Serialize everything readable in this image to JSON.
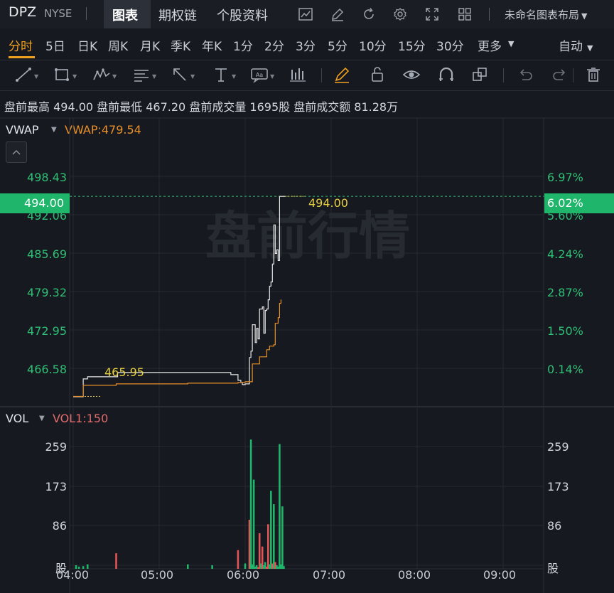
{
  "header": {
    "ticker": "DPZ",
    "exchange": "NYSE",
    "tabs": [
      "图表",
      "期权链",
      "个股资料"
    ],
    "active_tab": "图表",
    "layout_label": "未命名图表布局"
  },
  "periods": {
    "items": [
      "分时",
      "5日",
      "日K",
      "周K",
      "月K",
      "季K",
      "年K",
      "1分",
      "2分",
      "3分",
      "5分",
      "10分",
      "15分",
      "30分",
      "更多"
    ],
    "active": "分时",
    "mode": "自动"
  },
  "drawing_tools": [
    "line-tool-icon",
    "rectangle-tool-icon",
    "pattern-tool-icon",
    "fibonacci-tool-icon",
    "arrow-tool-icon",
    "text-tool-icon",
    "note-tool-icon",
    "measure-tool-icon",
    "pen-icon",
    "lock-icon",
    "eye-icon",
    "magnet-icon",
    "copy-icon",
    "undo-icon",
    "redo-icon",
    "trash-icon"
  ],
  "stats_line": "盘前最高 494.00 盘前最低 467.20 盘前成交量 1695股 盘前成交额 81.28万",
  "price_pane": {
    "indicator_name": "VWAP",
    "indicator_value": "VWAP:479.54",
    "watermark": "盘前行情",
    "current_price": "494.00",
    "current_pct": "6.02%",
    "line_label_high": "494.00",
    "line_label_low": "465.95",
    "left_axis": [
      "498.43",
      "492.06",
      "485.69",
      "479.32",
      "472.95",
      "466.58"
    ],
    "right_axis": [
      "6.97%",
      "5.60%",
      "4.24%",
      "2.87%",
      "1.50%",
      "0.14%"
    ]
  },
  "volume_pane": {
    "indicator_name": "VOL",
    "indicator_value": "VOL1:150",
    "axis": [
      "259",
      "173",
      "86",
      "股"
    ]
  },
  "time_axis": [
    "04:00",
    "05:00",
    "06:00",
    "07:00",
    "08:00",
    "09:00"
  ],
  "colors": {
    "up": "#1fb56b",
    "down": "#e05555",
    "accent": "#f0a020",
    "vwap": "#e8902a",
    "price_line": "#e8e8e8",
    "label_yellow": "#e8d040"
  },
  "chart_data": {
    "type": "line",
    "x_range": [
      "04:00",
      "09:30"
    ],
    "ylim": [
      464.5,
      500.5
    ],
    "series": [
      {
        "name": "",
        "x": [
          "04:00",
          "04:07",
          "04:10",
          "04:30",
          "04:31",
          "05:20",
          "05:50",
          "05:55",
          "05:57",
          "05:58",
          "06:00",
          "06:03",
          "06:04",
          "06:05",
          "06:07",
          "06:08",
          "06:09",
          "06:10",
          "06:12",
          "06:13",
          "06:14",
          "06:15",
          "06:16",
          "06:17",
          "06:18",
          "06:19",
          "06:20",
          "06:21",
          "06:22",
          "06:23",
          "06:24",
          "06:25",
          "06:26",
          "06:27",
          "06:28"
        ],
        "values": [
          465.9,
          468.4,
          468.7,
          468.7,
          469.3,
          469.3,
          469.0,
          468.2,
          467.9,
          467.6,
          467.7,
          471.4,
          472.3,
          476.0,
          473.5,
          475.5,
          474.0,
          478.2,
          478.5,
          474.8,
          478.0,
          478.2,
          479.5,
          481.4,
          482.0,
          484.5,
          490.0,
          486.0,
          486.5,
          485.0,
          494.0,
          494.0,
          494.0,
          494.0,
          494.0
        ]
      },
      {
        "name": "VWAP",
        "x": [
          "04:00",
          "04:07",
          "04:30",
          "05:20",
          "05:55",
          "06:00",
          "06:05",
          "06:10",
          "06:15",
          "06:17",
          "06:20",
          "06:21",
          "06:23",
          "06:24",
          "06:25"
        ],
        "values": [
          465.95,
          467.5,
          467.7,
          467.8,
          467.9,
          468.0,
          470.5,
          471.5,
          472.5,
          473.0,
          473.2,
          476.2,
          477.0,
          479.0,
          479.54
        ]
      }
    ],
    "volume": {
      "x": [
        "04:02",
        "04:04",
        "04:07",
        "04:10",
        "04:30",
        "05:20",
        "05:37",
        "05:55",
        "06:00",
        "06:03",
        "06:04",
        "06:05",
        "06:06",
        "06:07",
        "06:08",
        "06:09",
        "06:10",
        "06:11",
        "06:12",
        "06:13",
        "06:14",
        "06:15",
        "06:16",
        "06:17",
        "06:18",
        "06:19",
        "06:20",
        "06:21",
        "06:22",
        "06:23",
        "06:24",
        "06:25",
        "06:26",
        "06:27"
      ],
      "values": [
        8,
        5,
        6,
        10,
        35,
        10,
        8,
        42,
        12,
        110,
        290,
        10,
        200,
        5,
        8,
        4,
        80,
        12,
        50,
        8,
        15,
        5,
        100,
        10,
        175,
        12,
        145,
        15,
        8,
        5,
        280,
        10,
        140,
        6
      ],
      "direction": [
        "up",
        "up",
        "up",
        "up",
        "down",
        "up",
        "up",
        "down",
        "up",
        "down",
        "up",
        "up",
        "up",
        "up",
        "up",
        "down",
        "down",
        "up",
        "down",
        "up",
        "up",
        "down",
        "down",
        "up",
        "up",
        "down",
        "up",
        "down",
        "up",
        "up",
        "up",
        "up",
        "up",
        "up"
      ]
    }
  }
}
